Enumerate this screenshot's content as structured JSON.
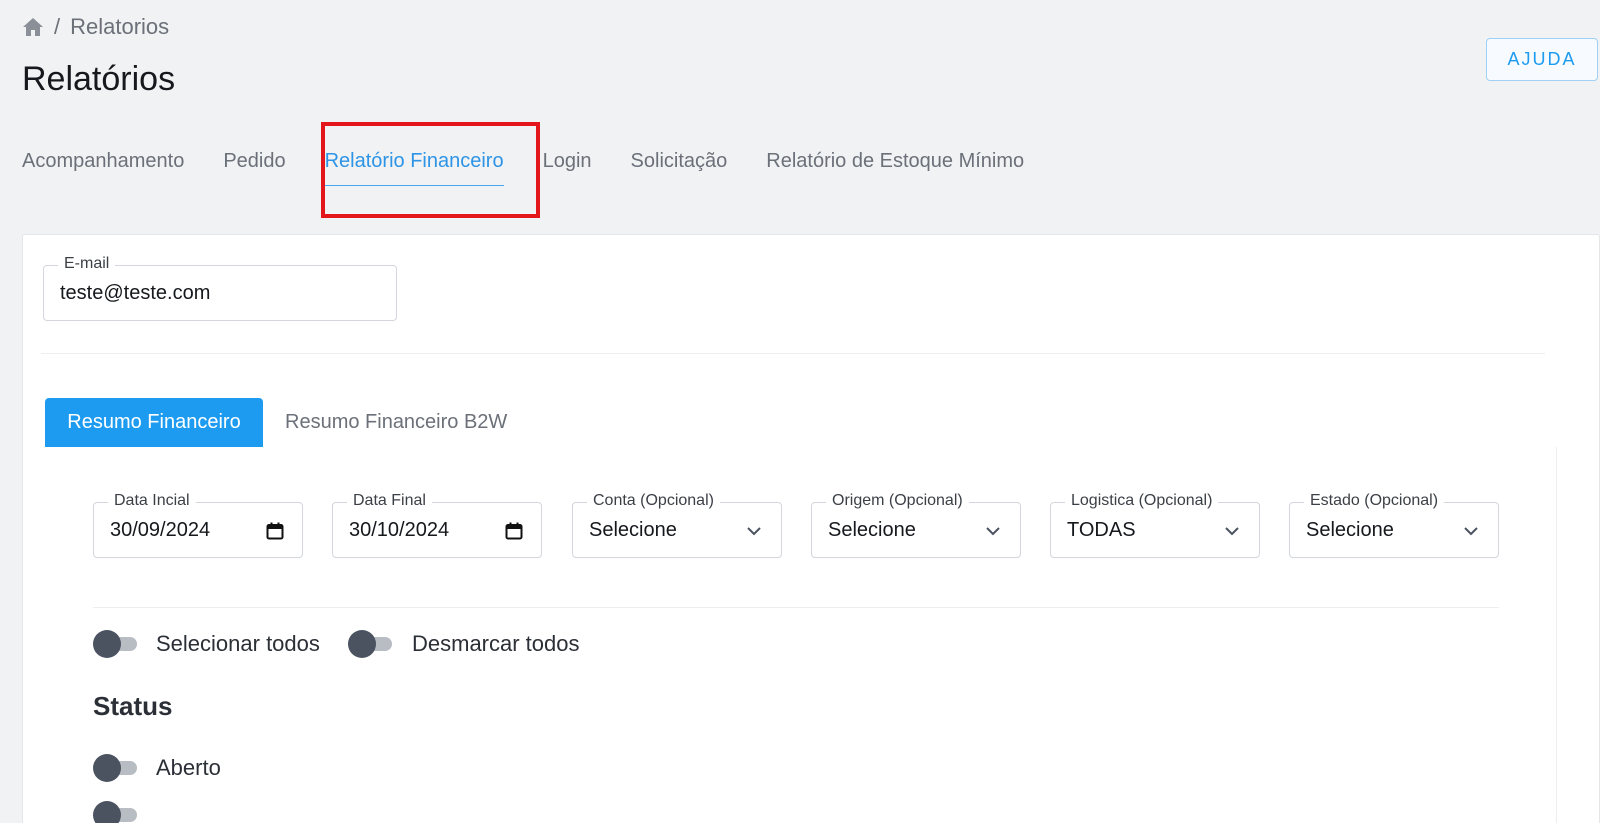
{
  "breadcrumb": {
    "current": "Relatorios"
  },
  "page_title": "Relatórios",
  "help_label": "AJUDA",
  "tabs": [
    {
      "label": "Acompanhamento",
      "active": false
    },
    {
      "label": "Pedido",
      "active": false
    },
    {
      "label": "Relatório Financeiro",
      "active": true
    },
    {
      "label": "Login",
      "active": false
    },
    {
      "label": "Solicitação",
      "active": false
    },
    {
      "label": "Relatório de Estoque Mínimo",
      "active": false
    }
  ],
  "email": {
    "label": "E-mail",
    "value": "teste@teste.com"
  },
  "subtabs": [
    {
      "label": "Resumo Financeiro",
      "active": true
    },
    {
      "label": "Resumo Financeiro B2W",
      "active": false
    }
  ],
  "filters": [
    {
      "label": "Data Incial",
      "value": "30/09/2024",
      "type": "date"
    },
    {
      "label": "Data Final",
      "value": "30/10/2024",
      "type": "date"
    },
    {
      "label": "Conta (Opcional)",
      "value": "Selecione",
      "type": "select"
    },
    {
      "label": "Origem (Opcional)",
      "value": "Selecione",
      "type": "select"
    },
    {
      "label": "Logistica (Opcional)",
      "value": "TODAS",
      "type": "select"
    },
    {
      "label": "Estado (Opcional)",
      "value": "Selecione",
      "type": "select"
    }
  ],
  "toggles": {
    "select_all": {
      "label": "Selecionar todos",
      "on": false
    },
    "deselect_all": {
      "label": "Desmarcar todos",
      "on": false
    }
  },
  "status": {
    "title": "Status",
    "items": [
      {
        "label": "Aberto",
        "on": false
      }
    ]
  },
  "colors": {
    "accent": "#1d9bf0",
    "highlight": "#e3161c"
  }
}
